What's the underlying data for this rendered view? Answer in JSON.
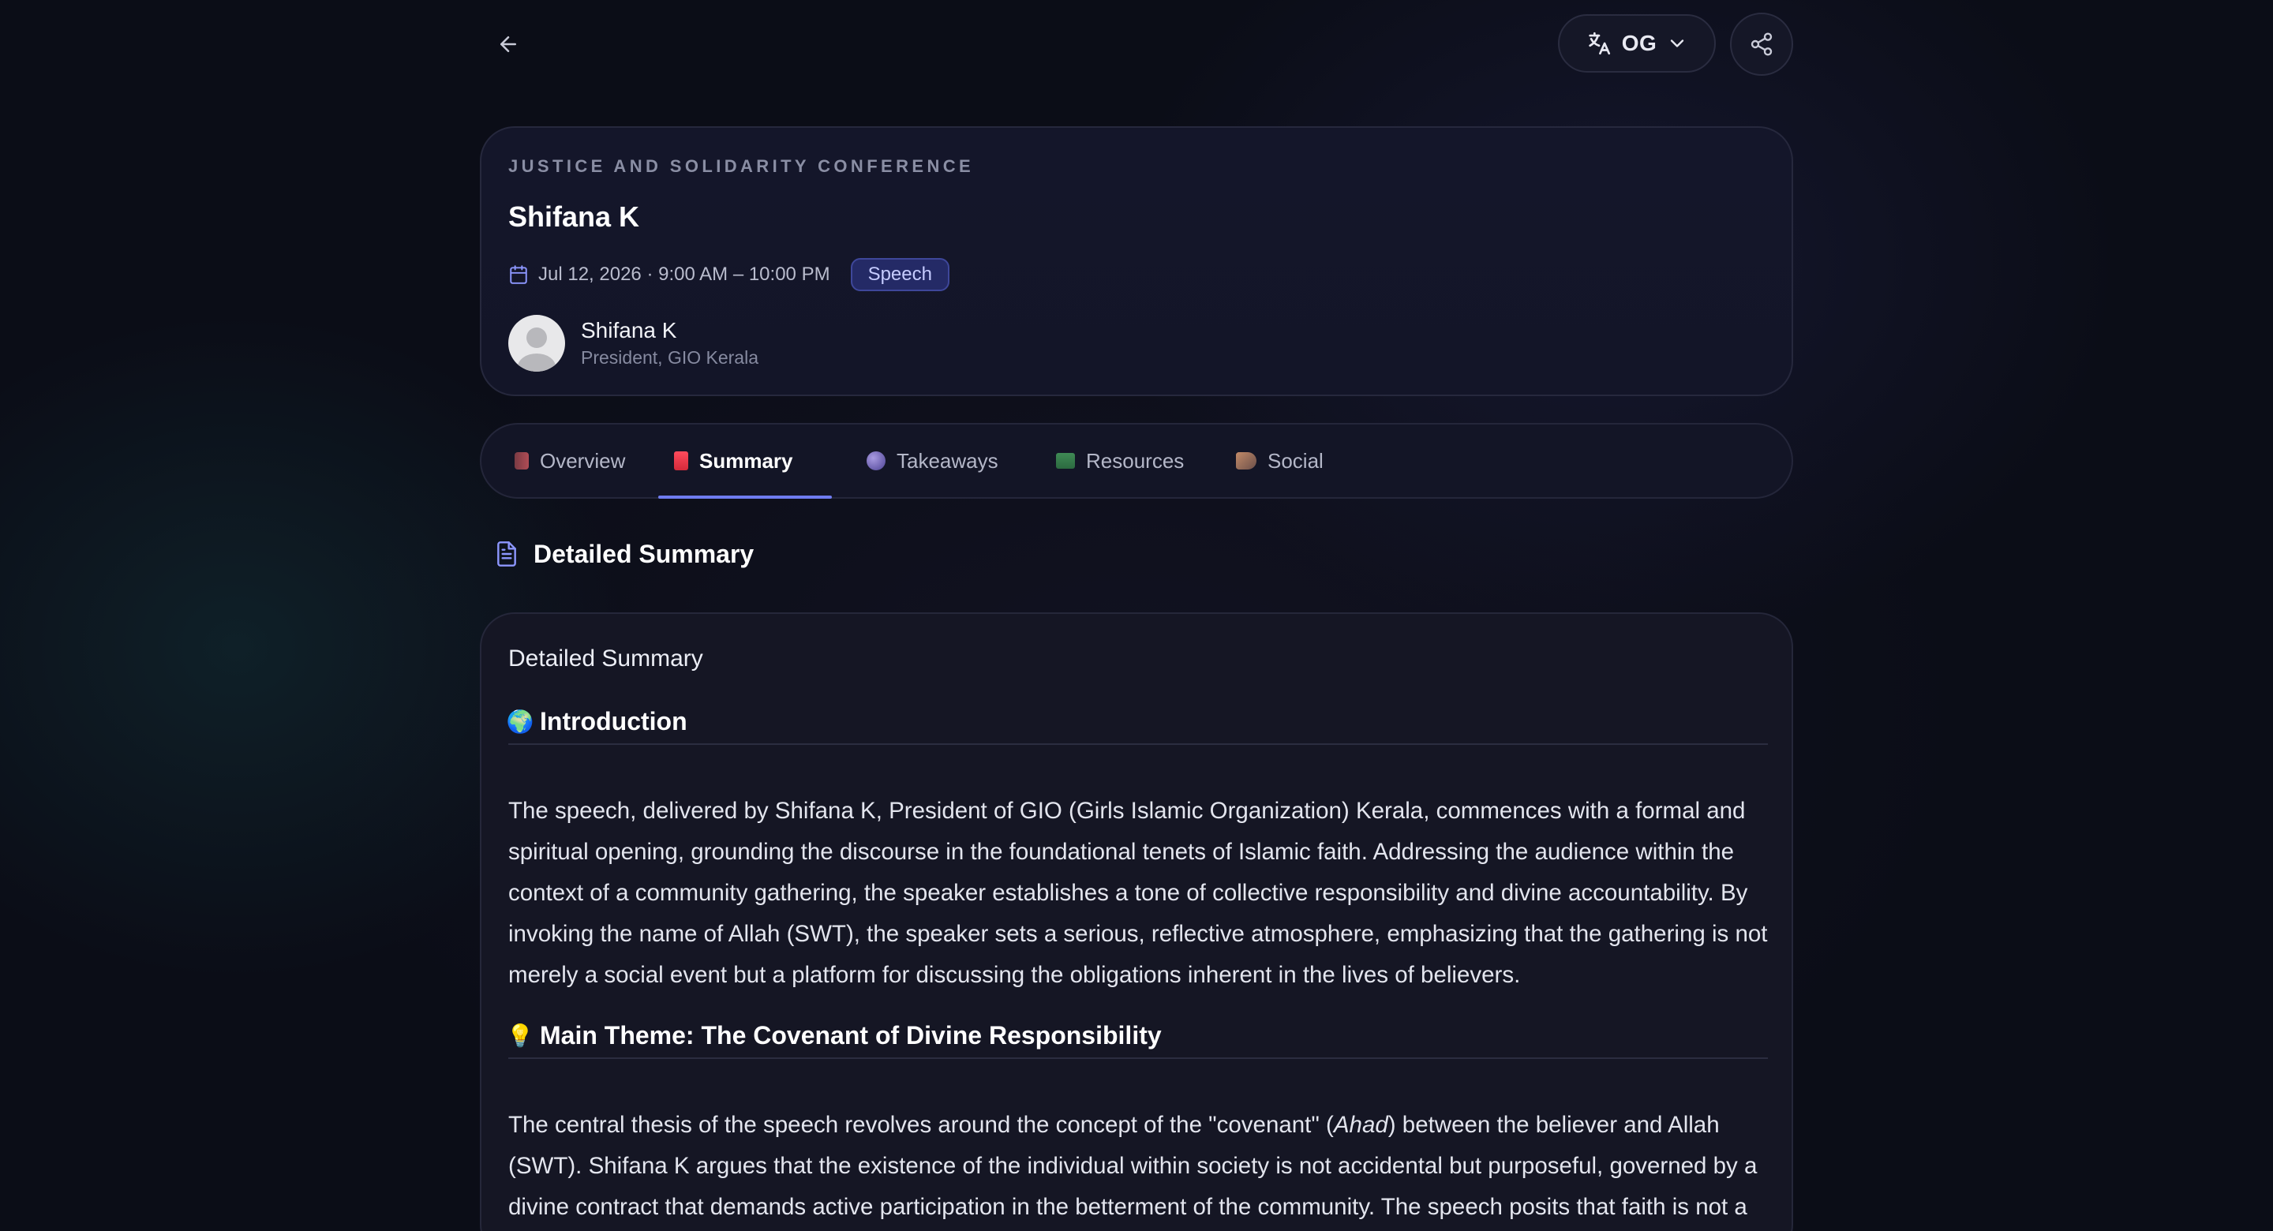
{
  "header": {
    "language_label": "OG"
  },
  "event": {
    "conference": "JUSTICE AND SOLIDARITY CONFERENCE",
    "title": "Shifana K",
    "datetime": "Jul 12, 2026 · 9:00 AM – 10:00 PM",
    "badge": "Speech",
    "speaker_name": "Shifana K",
    "speaker_role": "President, GIO Kerala"
  },
  "tabs": [
    {
      "label": "Overview",
      "icon": "book-icon",
      "active": false
    },
    {
      "label": "Summary",
      "icon": "memo-icon",
      "active": true
    },
    {
      "label": "Takeaways",
      "icon": "orb-icon",
      "active": false
    },
    {
      "label": "Resources",
      "icon": "folder-icon",
      "active": false
    },
    {
      "label": "Social",
      "icon": "megaphone-icon",
      "active": false
    }
  ],
  "section": {
    "title": "Detailed Summary"
  },
  "content": {
    "heading": "Detailed Summary",
    "introduction": {
      "emoji": "🌍",
      "title": "Introduction",
      "text": "The speech, delivered by Shifana K, President of GIO (Girls Islamic Organization) Kerala, commences with a formal and spiritual opening, grounding the discourse in the foundational tenets of Islamic faith. Addressing the audience within the context of a community gathering, the speaker establishes a tone of collective responsibility and divine accountability. By invoking the name of Allah (SWT), the speaker sets a serious, reflective atmosphere, emphasizing that the gathering is not merely a social event but a platform for discussing the obligations inherent in the lives of believers."
    },
    "main_theme": {
      "emoji": "💡",
      "title": "Main Theme: The Covenant of Divine Responsibility",
      "text_before": "The central thesis of the speech revolves around the concept of the \"covenant\" (",
      "text_italic": "Ahad",
      "text_after": ") between the believer and Allah (SWT). Shifana K argues that the existence of the individual within society is not accidental but purposeful, governed by a divine contract that demands active participation in the betterment of the community. The speech posits that faith is not a"
    }
  }
}
